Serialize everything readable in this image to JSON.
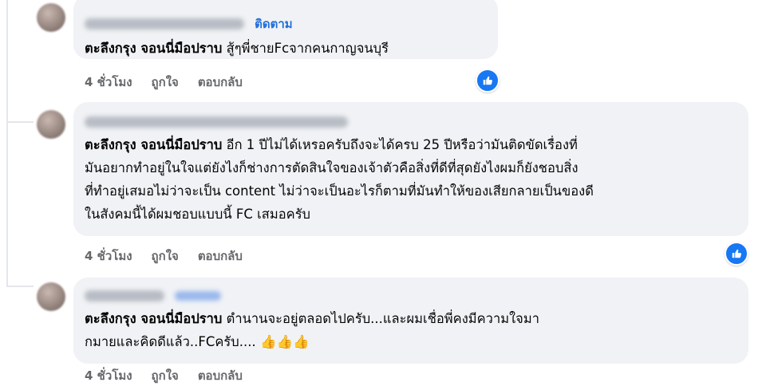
{
  "comments": [
    {
      "follow_label": "ติดตาม",
      "tag": "ตะลึงกรุง จอนนี่มือปราบ",
      "lines": [
        "สู้ๆพี่ชายFcจากคนกาญจนบุรี"
      ],
      "time": "4 ชั่วโมง",
      "like": "ถูกใจ",
      "reply": "ตอบกลับ",
      "reaction_icon": "like-icon"
    },
    {
      "tag": "ตะลึงกรุง จอนนี่มือปราบ",
      "lines": [
        "อีก 1 ปีไม่ได้เหรอครับถึงจะได้ครบ 25 ปีหรือว่ามันติดขัดเรื่องที่",
        "มันอยากทำอยู่ในใจแต่ยังไงก็ช่างการตัดสินใจของเจ้าตัวคือสิ่งที่ดีที่สุดยังไงผมก็ยังชอบสิ่ง",
        "ที่ทำอยู่เสมอไม่ว่าจะเป็น content ไม่ว่าจะเป็นอะไรก็ตามที่มันทำให้ของเสียกลายเป็นของดี",
        "ในสังคมนี้ได้ผมชอบแบบนี้ FC เสมอครับ"
      ],
      "time": "4 ชั่วโมง",
      "like": "ถูกใจ",
      "reply": "ตอบกลับ",
      "reaction_icon": "like-icon"
    },
    {
      "tag": "ตะลึงกรุง จอนนี่มือปราบ",
      "lines": [
        "ตำนานจะอยู่ตลอดไปครับ...และผมเชื่อพี่คงมีความใจมา",
        "กมายและคิดดีแล้ว..FCครับ...."
      ],
      "emoji": "👍👍👍",
      "time": "4 ชั่วโมง",
      "like": "ถูกใจ",
      "reply": "ตอบกลับ"
    }
  ],
  "colors": {
    "bubble": "#f0f2f5",
    "action_text": "#65676b",
    "follow": "#216fdb",
    "like_badge": "#1877f2"
  }
}
